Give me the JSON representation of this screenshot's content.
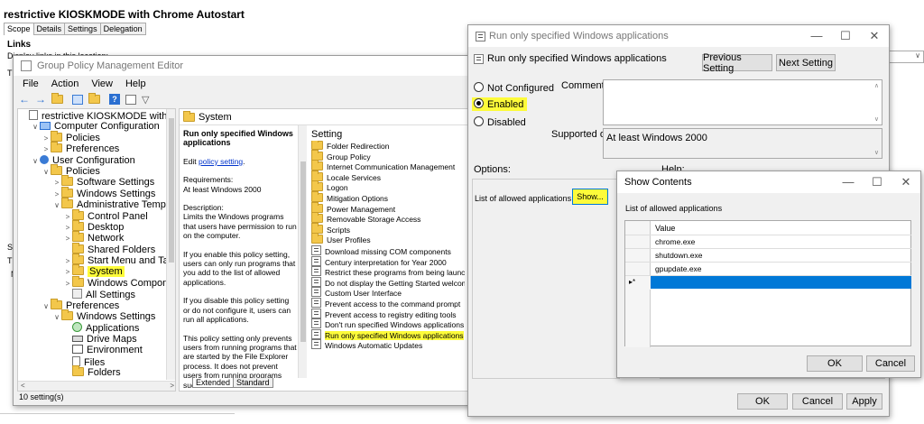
{
  "gpo_title": "restrictive KIOSKMODE with Chrome Autostart",
  "gpo_tabs": [
    "Scope",
    "Details",
    "Settings",
    "Delegation"
  ],
  "links_heading": "Links",
  "display_links_label": "Display links in this location:",
  "frag_th": "Th",
  "frag_se": "Se",
  "frag_th2": "Th",
  "frag_n": "N",
  "gpme": {
    "title": "Group Policy Management Editor",
    "menu": [
      "File",
      "Action",
      "View",
      "Help"
    ],
    "tree": [
      {
        "label": "restrictive KIOSKMODE with Chrome Au",
        "indent": 0,
        "caret": "",
        "icon": "doc"
      },
      {
        "label": "Computer Configuration",
        "indent": 1,
        "caret": "∨",
        "icon": "computer"
      },
      {
        "label": "Policies",
        "indent": 2,
        "caret": ">",
        "icon": "folder"
      },
      {
        "label": "Preferences",
        "indent": 2,
        "caret": ">",
        "icon": "folder"
      },
      {
        "label": "User Configuration",
        "indent": 1,
        "caret": "∨",
        "icon": "user"
      },
      {
        "label": "Policies",
        "indent": 2,
        "caret": "∨",
        "icon": "folder"
      },
      {
        "label": "Software Settings",
        "indent": 3,
        "caret": ">",
        "icon": "folder"
      },
      {
        "label": "Windows Settings",
        "indent": 3,
        "caret": ">",
        "icon": "folder"
      },
      {
        "label": "Administrative Templates: Po",
        "indent": 3,
        "caret": "∨",
        "icon": "folder"
      },
      {
        "label": "Control Panel",
        "indent": 4,
        "caret": ">",
        "icon": "folder"
      },
      {
        "label": "Desktop",
        "indent": 4,
        "caret": ">",
        "icon": "folder"
      },
      {
        "label": "Network",
        "indent": 4,
        "caret": ">",
        "icon": "folder"
      },
      {
        "label": "Shared Folders",
        "indent": 4,
        "caret": "",
        "icon": "folder"
      },
      {
        "label": "Start Menu and Taskbar",
        "indent": 4,
        "caret": ">",
        "icon": "folder"
      },
      {
        "label": "System",
        "indent": 4,
        "caret": ">",
        "icon": "folder",
        "highlight": true
      },
      {
        "label": "Windows Components",
        "indent": 4,
        "caret": ">",
        "icon": "folder"
      },
      {
        "label": "All Settings",
        "indent": 4,
        "caret": "",
        "icon": "settings"
      },
      {
        "label": "Preferences",
        "indent": 2,
        "caret": "∨",
        "icon": "folder"
      },
      {
        "label": "Windows Settings",
        "indent": 3,
        "caret": "∨",
        "icon": "folder"
      },
      {
        "label": "Applications",
        "indent": 4,
        "caret": "",
        "icon": "app"
      },
      {
        "label": "Drive Maps",
        "indent": 4,
        "caret": "",
        "icon": "drive"
      },
      {
        "label": "Environment",
        "indent": 4,
        "caret": "",
        "icon": "env"
      },
      {
        "label": "Files",
        "indent": 4,
        "caret": "",
        "icon": "file"
      },
      {
        "label": "Folders",
        "indent": 4,
        "caret": "",
        "icon": "folder"
      }
    ],
    "system_header": "System",
    "policy_name": "Run only specified Windows applications",
    "edit_prefix": "Edit ",
    "edit_link": "policy setting",
    "edit_suffix": ".",
    "requirements_label": "Requirements:",
    "requirements_value": "At least Windows 2000",
    "description_label": "Description:",
    "description": "Limits the Windows programs that users have permission to run on the computer.",
    "desc_p2": "If you enable this policy setting, users can only run programs that you add to the list of allowed applications.",
    "desc_p3": "If you disable this policy setting or do not configure it, users can run all applications.",
    "desc_p4": "This policy setting only prevents users from running programs that are started by the File Explorer process.  It does not prevent users from running programs such as",
    "setting_header": "Setting",
    "settings_folders": [
      "Folder Redirection",
      "Group Policy",
      "Internet Communication Management",
      "Locale Services",
      "Logon",
      "Mitigation Options",
      "Power Management",
      "Removable Storage Access",
      "Scripts",
      "User Profiles"
    ],
    "settings_policies": [
      "Download missing COM components",
      "Century interpretation for Year 2000",
      "Restrict these programs from being launched",
      "Do not display the Getting Started welcome sc",
      "Custom User Interface",
      "Prevent access to the command prompt",
      "Prevent access to registry editing tools",
      "Don't run specified Windows applications",
      "Run only specified Windows applications",
      "Windows Automatic Updates"
    ],
    "tab_extended": "Extended",
    "tab_standard": "Standard",
    "status": "10 setting(s)"
  },
  "dlg": {
    "title": "Run only specified Windows applications",
    "heading": "Run only specified Windows applications",
    "prev": "Previous Setting",
    "next": "Next Setting",
    "not_configured": "Not Configured",
    "enabled": "Enabled",
    "disabled": "Disabled",
    "comment": "Comment:",
    "supported_on": "Supported on:",
    "supported_value": "At least Windows 2000",
    "options": "Options:",
    "help": "Help:",
    "allowed_label": "List of allowed applications",
    "show": "Show...",
    "ok": "OK",
    "cancel": "Cancel",
    "apply": "Apply"
  },
  "show": {
    "title": "Show Contents",
    "label": "List of allowed applications",
    "col": "Value",
    "rows": [
      "chrome.exe",
      "shutdown.exe",
      "gpupdate.exe"
    ],
    "new_marker": "▸*",
    "ok": "OK",
    "cancel": "Cancel"
  },
  "colors": {
    "highlight": "#fdfb3a",
    "selection": "#0078d7",
    "link": "#0033cc"
  }
}
